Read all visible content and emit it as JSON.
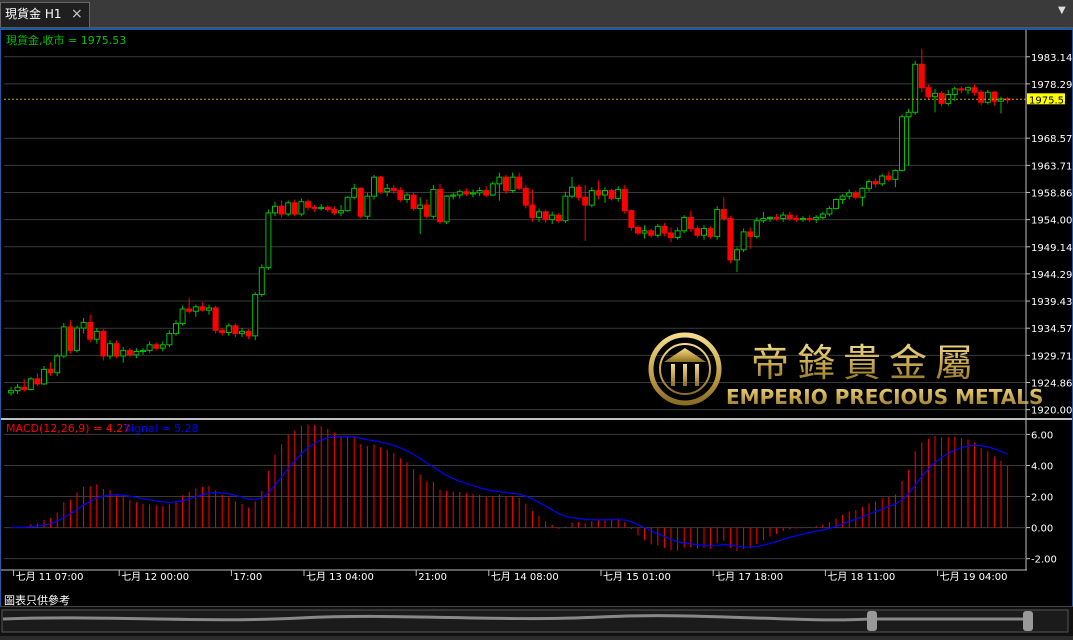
{
  "tab": {
    "label": "現貨金 H1",
    "close": "×"
  },
  "menu_icon": "menu-arrow-icon",
  "disclaimer": "圖表只供參考",
  "price_panel": {
    "header": "現貨金,收市 = 1975.53",
    "current_price": "1975.53",
    "current_color": "#ffff00",
    "bull_color": "#00c000",
    "bear_color": "#ff0000"
  },
  "macd_panel": {
    "header_main": "MACD(12,26,9) = 4.27",
    "header_signal": "Signal = 5.28",
    "main_color": "#ff0000",
    "signal_color": "#0000ff"
  },
  "logo": {
    "chinese": "帝鋒貴金屬",
    "english": "EMPERIO PRECIOUS METALS",
    "color": "#c9a94f"
  },
  "chart_data": [
    {
      "type": "candlestick",
      "series_name": "現貨金",
      "ylim": [
        1918.5,
        1986.5
      ],
      "y_ticks": [
        "1983.14",
        "1978.29",
        "1968.57",
        "1963.71",
        "1958.86",
        "1954.00",
        "1949.14",
        "1944.29",
        "1939.43",
        "1934.57",
        "1929.71",
        "1924.86",
        "1920.00"
      ],
      "x_ticks": [
        {
          "label": "七月 11 07:00",
          "index": 1
        },
        {
          "label": "七月 12 00:00",
          "index": 17
        },
        {
          "label": "17:00",
          "index": 34
        },
        {
          "label": "七月 13 04:00",
          "index": 45
        },
        {
          "label": "21:00",
          "index": 62
        },
        {
          "label": "七月 14 08:00",
          "index": 73
        },
        {
          "label": "七月 15 01:00",
          "index": 90
        },
        {
          "label": "七月 17 18:00",
          "index": 107
        },
        {
          "label": "七月 18 11:00",
          "index": 124
        },
        {
          "label": "七月 19 04:00",
          "index": 141
        }
      ],
      "ohlc": [
        [
          1923.0,
          1924.0,
          1922.5,
          1923.4
        ],
        [
          1923.4,
          1924.6,
          1922.8,
          1924.0
        ],
        [
          1924.0,
          1925.5,
          1923.2,
          1923.6
        ],
        [
          1923.6,
          1925.8,
          1923.4,
          1925.5
        ],
        [
          1925.5,
          1926.5,
          1924.2,
          1924.6
        ],
        [
          1924.6,
          1927.8,
          1924.4,
          1927.2
        ],
        [
          1927.2,
          1928.5,
          1926.0,
          1926.6
        ],
        [
          1926.6,
          1930.0,
          1926.0,
          1929.6
        ],
        [
          1929.6,
          1935.5,
          1929.2,
          1934.8
        ],
        [
          1934.8,
          1936.0,
          1930.0,
          1930.6
        ],
        [
          1930.6,
          1935.0,
          1930.2,
          1934.6
        ],
        [
          1934.6,
          1936.4,
          1933.6,
          1935.6
        ],
        [
          1935.6,
          1937.0,
          1932.0,
          1932.6
        ],
        [
          1932.6,
          1934.6,
          1931.8,
          1934.0
        ],
        [
          1934.0,
          1934.4,
          1928.8,
          1929.6
        ],
        [
          1929.6,
          1932.5,
          1929.0,
          1931.8
        ],
        [
          1931.8,
          1932.4,
          1929.2,
          1929.6
        ],
        [
          1929.6,
          1931.2,
          1928.4,
          1930.6
        ],
        [
          1930.6,
          1931.0,
          1929.4,
          1929.8
        ],
        [
          1929.8,
          1931.0,
          1929.2,
          1930.4
        ],
        [
          1930.4,
          1931.0,
          1929.8,
          1930.6
        ],
        [
          1930.6,
          1932.2,
          1930.2,
          1931.6
        ],
        [
          1931.6,
          1932.0,
          1930.6,
          1931.0
        ],
        [
          1931.0,
          1932.2,
          1930.4,
          1931.6
        ],
        [
          1931.6,
          1934.2,
          1931.2,
          1933.6
        ],
        [
          1933.6,
          1936.0,
          1933.2,
          1935.4
        ],
        [
          1935.4,
          1938.6,
          1935.0,
          1938.0
        ],
        [
          1938.0,
          1940.0,
          1937.2,
          1937.6
        ],
        [
          1937.6,
          1938.8,
          1936.6,
          1938.4
        ],
        [
          1938.4,
          1939.2,
          1937.6,
          1937.8
        ],
        [
          1937.8,
          1938.8,
          1937.0,
          1938.2
        ],
        [
          1938.2,
          1938.6,
          1933.6,
          1934.2
        ],
        [
          1934.2,
          1934.6,
          1933.2,
          1933.8
        ],
        [
          1933.8,
          1935.4,
          1933.2,
          1935.0
        ],
        [
          1935.0,
          1935.4,
          1933.0,
          1933.6
        ],
        [
          1933.6,
          1934.6,
          1933.0,
          1934.0
        ],
        [
          1934.0,
          1934.4,
          1932.6,
          1933.2
        ],
        [
          1933.2,
          1941.0,
          1932.4,
          1940.6
        ],
        [
          1940.6,
          1946.0,
          1940.2,
          1945.4
        ],
        [
          1945.4,
          1955.8,
          1945.0,
          1955.2
        ],
        [
          1955.2,
          1957.2,
          1954.6,
          1956.4
        ],
        [
          1956.4,
          1957.4,
          1954.4,
          1955.0
        ],
        [
          1955.0,
          1957.4,
          1954.6,
          1957.0
        ],
        [
          1957.0,
          1957.6,
          1954.6,
          1955.0
        ],
        [
          1955.0,
          1957.8,
          1954.6,
          1957.2
        ],
        [
          1957.2,
          1957.6,
          1955.6,
          1956.2
        ],
        [
          1956.2,
          1956.6,
          1955.4,
          1956.0
        ],
        [
          1956.0,
          1956.8,
          1955.6,
          1956.2
        ],
        [
          1956.2,
          1956.6,
          1955.4,
          1955.8
        ],
        [
          1955.8,
          1956.4,
          1954.8,
          1955.2
        ],
        [
          1955.2,
          1956.6,
          1954.6,
          1955.6
        ],
        [
          1955.6,
          1958.2,
          1955.4,
          1958.0
        ],
        [
          1958.0,
          1960.4,
          1957.6,
          1959.6
        ],
        [
          1959.6,
          1959.8,
          1954.2,
          1954.6
        ],
        [
          1954.6,
          1958.8,
          1954.0,
          1958.2
        ],
        [
          1958.2,
          1962.0,
          1957.6,
          1961.6
        ],
        [
          1961.6,
          1961.8,
          1958.6,
          1959.0
        ],
        [
          1959.0,
          1960.4,
          1958.2,
          1959.6
        ],
        [
          1959.6,
          1960.2,
          1958.6,
          1959.2
        ],
        [
          1959.2,
          1959.8,
          1957.2,
          1957.6
        ],
        [
          1957.6,
          1958.8,
          1957.0,
          1958.4
        ],
        [
          1958.4,
          1958.8,
          1955.6,
          1956.0
        ],
        [
          1956.0,
          1958.0,
          1951.4,
          1956.6
        ],
        [
          1956.6,
          1957.6,
          1954.2,
          1954.6
        ],
        [
          1954.6,
          1960.2,
          1954.2,
          1959.4
        ],
        [
          1959.4,
          1960.4,
          1953.2,
          1953.6
        ],
        [
          1953.6,
          1958.4,
          1953.2,
          1958.2
        ],
        [
          1958.2,
          1958.8,
          1957.6,
          1958.4
        ],
        [
          1958.4,
          1959.4,
          1957.8,
          1959.0
        ],
        [
          1959.0,
          1959.6,
          1958.2,
          1958.6
        ],
        [
          1958.6,
          1959.4,
          1958.0,
          1958.8
        ],
        [
          1958.8,
          1959.8,
          1958.2,
          1959.2
        ],
        [
          1959.2,
          1960.0,
          1958.0,
          1958.4
        ],
        [
          1958.4,
          1960.8,
          1958.2,
          1960.4
        ],
        [
          1960.4,
          1962.4,
          1957.4,
          1961.6
        ],
        [
          1961.6,
          1962.0,
          1958.6,
          1959.2
        ],
        [
          1959.2,
          1962.4,
          1958.8,
          1961.6
        ],
        [
          1961.6,
          1962.4,
          1959.2,
          1959.6
        ],
        [
          1959.6,
          1960.2,
          1956.0,
          1956.6
        ],
        [
          1956.6,
          1959.4,
          1953.6,
          1954.4
        ],
        [
          1954.4,
          1956.0,
          1953.6,
          1955.4
        ],
        [
          1955.4,
          1955.8,
          1953.4,
          1954.0
        ],
        [
          1954.0,
          1955.4,
          1953.2,
          1954.8
        ],
        [
          1954.8,
          1955.2,
          1953.4,
          1953.8
        ],
        [
          1953.8,
          1959.0,
          1953.4,
          1958.2
        ],
        [
          1958.2,
          1961.6,
          1957.8,
          1959.8
        ],
        [
          1959.8,
          1960.2,
          1957.4,
          1958.0
        ],
        [
          1958.0,
          1960.2,
          1950.2,
          1956.6
        ],
        [
          1956.6,
          1959.8,
          1956.2,
          1959.2
        ],
        [
          1959.2,
          1961.0,
          1957.6,
          1958.4
        ],
        [
          1958.4,
          1959.8,
          1957.0,
          1959.2
        ],
        [
          1959.2,
          1959.6,
          1957.4,
          1957.8
        ],
        [
          1957.8,
          1960.0,
          1957.2,
          1959.4
        ],
        [
          1959.4,
          1960.2,
          1955.0,
          1955.6
        ],
        [
          1955.6,
          1955.8,
          1952.0,
          1952.6
        ],
        [
          1952.6,
          1953.0,
          1951.2,
          1951.6
        ],
        [
          1951.6,
          1953.0,
          1950.6,
          1952.0
        ],
        [
          1952.0,
          1952.4,
          1950.8,
          1951.2
        ],
        [
          1951.2,
          1953.2,
          1950.8,
          1952.8
        ],
        [
          1952.8,
          1953.4,
          1951.0,
          1951.6
        ],
        [
          1951.6,
          1952.6,
          1950.0,
          1950.8
        ],
        [
          1950.8,
          1952.6,
          1950.4,
          1952.0
        ],
        [
          1952.0,
          1954.8,
          1951.6,
          1954.4
        ],
        [
          1954.4,
          1955.6,
          1951.8,
          1952.4
        ],
        [
          1952.4,
          1953.0,
          1950.8,
          1951.2
        ],
        [
          1951.2,
          1953.0,
          1950.4,
          1952.4
        ],
        [
          1952.4,
          1952.8,
          1950.6,
          1951.0
        ],
        [
          1951.0,
          1956.4,
          1950.4,
          1955.8
        ],
        [
          1955.8,
          1958.0,
          1953.8,
          1954.2
        ],
        [
          1954.2,
          1954.6,
          1946.2,
          1946.8
        ],
        [
          1946.8,
          1949.0,
          1944.6,
          1948.6
        ],
        [
          1948.6,
          1952.4,
          1948.2,
          1951.8
        ],
        [
          1951.8,
          1952.6,
          1948.8,
          1951.0
        ],
        [
          1951.0,
          1954.4,
          1950.6,
          1953.8
        ],
        [
          1953.8,
          1955.4,
          1953.4,
          1954.2
        ],
        [
          1954.2,
          1954.6,
          1953.6,
          1954.4
        ],
        [
          1954.4,
          1955.0,
          1953.8,
          1954.2
        ],
        [
          1954.2,
          1955.4,
          1953.6,
          1954.8
        ],
        [
          1954.8,
          1955.4,
          1953.8,
          1954.2
        ],
        [
          1954.2,
          1954.8,
          1953.6,
          1954.0
        ],
        [
          1954.0,
          1954.6,
          1953.6,
          1954.2
        ],
        [
          1954.2,
          1954.8,
          1953.6,
          1954.0
        ],
        [
          1954.0,
          1954.8,
          1953.4,
          1954.4
        ],
        [
          1954.4,
          1955.4,
          1954.0,
          1955.0
        ],
        [
          1955.0,
          1956.4,
          1954.6,
          1956.0
        ],
        [
          1956.0,
          1957.8,
          1955.8,
          1957.6
        ],
        [
          1957.6,
          1958.6,
          1956.8,
          1958.2
        ],
        [
          1958.2,
          1959.4,
          1957.6,
          1958.8
        ],
        [
          1958.8,
          1959.2,
          1957.6,
          1958.0
        ],
        [
          1958.0,
          1959.8,
          1956.4,
          1959.6
        ],
        [
          1959.6,
          1961.2,
          1959.0,
          1960.8
        ],
        [
          1960.8,
          1961.4,
          1959.8,
          1960.4
        ],
        [
          1960.4,
          1962.2,
          1960.0,
          1961.8
        ],
        [
          1961.8,
          1962.6,
          1960.8,
          1961.2
        ],
        [
          1961.2,
          1963.0,
          1959.8,
          1962.8
        ],
        [
          1962.8,
          1972.8,
          1962.6,
          1972.4
        ],
        [
          1972.4,
          1973.8,
          1963.6,
          1973.2
        ],
        [
          1973.2,
          1982.4,
          1972.8,
          1981.8
        ],
        [
          1981.8,
          1984.6,
          1976.8,
          1977.6
        ],
        [
          1977.6,
          1978.2,
          1975.4,
          1976.0
        ],
        [
          1976.0,
          1977.4,
          1973.2,
          1976.6
        ],
        [
          1976.6,
          1977.0,
          1974.2,
          1974.8
        ],
        [
          1974.8,
          1977.2,
          1974.4,
          1976.4
        ],
        [
          1976.4,
          1977.8,
          1975.2,
          1977.4
        ],
        [
          1977.4,
          1977.8,
          1976.6,
          1977.2
        ],
        [
          1977.2,
          1977.8,
          1976.4,
          1977.6
        ],
        [
          1977.6,
          1978.2,
          1976.2,
          1976.8
        ],
        [
          1976.8,
          1977.2,
          1974.4,
          1975.0
        ],
        [
          1975.0,
          1977.2,
          1974.6,
          1976.8
        ],
        [
          1976.8,
          1977.0,
          1974.4,
          1975.2
        ],
        [
          1975.2,
          1976.0,
          1973.0,
          1975.6
        ],
        [
          1975.6,
          1976.0,
          1974.8,
          1975.53
        ]
      ]
    },
    {
      "type": "macd",
      "series_name": "MACD(12,26,9)",
      "params": [
        12,
        26,
        9
      ],
      "ylim": [
        -2.6,
        6.8
      ],
      "y_ticks": [
        "6.00",
        "4.00",
        "2.00",
        "0.00",
        "-2.00"
      ],
      "last_main": 4.27,
      "last_signal": 5.28
    }
  ]
}
